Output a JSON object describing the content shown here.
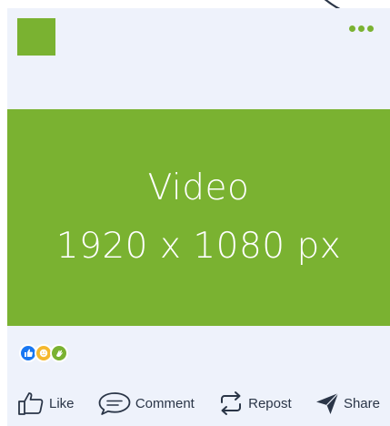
{
  "colors": {
    "accent": "#7ab231",
    "card_background": "#eef2fb",
    "text": "#2a3547",
    "like_reaction": "#1877f2",
    "love_reaction": "#f5b82e",
    "clap_reaction": "#7ab231"
  },
  "post": {
    "avatar_icon": "avatar-placeholder",
    "menu_icon": "more-dots-icon",
    "media": {
      "line1": "Video",
      "line2": "1920 x 1080 px"
    },
    "reactions": [
      {
        "icon": "thumbs-up-icon",
        "color": "#1877f2"
      },
      {
        "icon": "smile-icon",
        "color": "#f5b82e"
      },
      {
        "icon": "clap-icon",
        "color": "#7ab231"
      }
    ],
    "actions": {
      "like": "Like",
      "comment": "Comment",
      "repost": "Repost",
      "share": "Share"
    }
  }
}
